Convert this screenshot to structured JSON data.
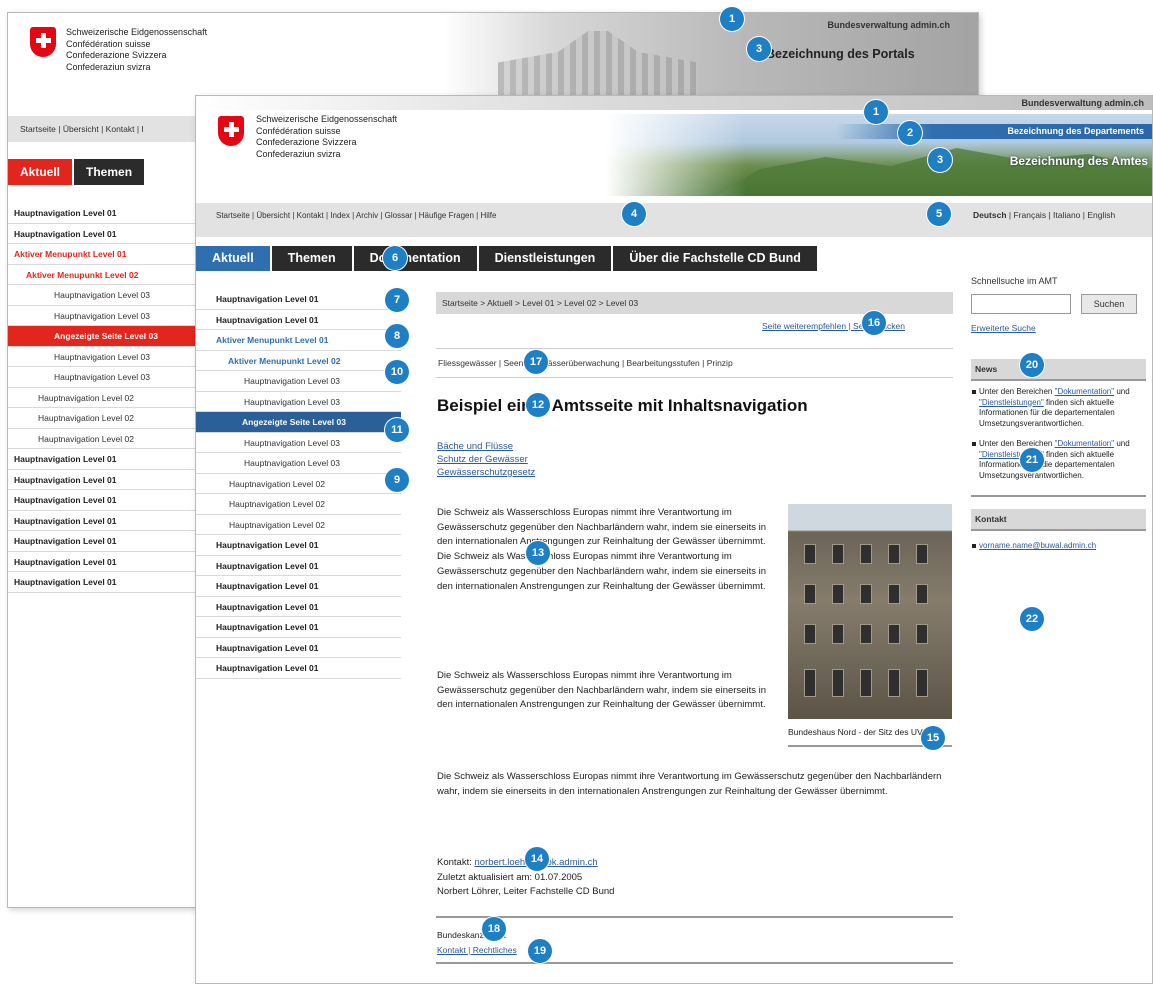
{
  "confederation": [
    "Schweizerische Eidgenossenschaft",
    "Confédération suisse",
    "Confederazione Svizzera",
    "Confederaziun svizra"
  ],
  "back": {
    "bundesverwaltung": "Bundesverwaltung admin.ch",
    "portal": "Bezeichnung des Portals",
    "service_links": "Startseite | Übersicht | Kontakt | I",
    "tabs": [
      "Aktuell",
      "Themen"
    ],
    "nav": [
      {
        "label": "Hauptnavigation Level 01",
        "type": "l1"
      },
      {
        "label": "Hauptnavigation Level 01",
        "type": "l1"
      },
      {
        "label": "Aktiver Menupunkt Level 01",
        "type": "act1"
      },
      {
        "label": "Aktiver Menupunkt Level 02",
        "type": "act2"
      },
      {
        "label": "Hauptnavigation Level 03",
        "type": "l3"
      },
      {
        "label": "Hauptnavigation Level 03",
        "type": "l3"
      },
      {
        "label": "Angezeigte Seite Level 03",
        "type": "cur3"
      },
      {
        "label": "Hauptnavigation Level 03",
        "type": "l3"
      },
      {
        "label": "Hauptnavigation Level 03",
        "type": "l3"
      },
      {
        "label": "Hauptnavigation Level 02",
        "type": "l2"
      },
      {
        "label": "Hauptnavigation Level 02",
        "type": "l2"
      },
      {
        "label": "Hauptnavigation Level 02",
        "type": "l2"
      },
      {
        "label": "Hauptnavigation Level 01",
        "type": "l1"
      },
      {
        "label": "Hauptnavigation Level 01",
        "type": "l1"
      },
      {
        "label": "Hauptnavigation Level 01",
        "type": "l1"
      },
      {
        "label": "Hauptnavigation Level 01",
        "type": "l1"
      },
      {
        "label": "Hauptnavigation Level 01",
        "type": "l1"
      },
      {
        "label": "Hauptnavigation Level 01",
        "type": "l1"
      },
      {
        "label": "Hauptnavigation Level 01",
        "type": "l1"
      }
    ]
  },
  "front": {
    "bundesverwaltung": "Bundesverwaltung admin.ch",
    "departement": "Bezeichnung des Departements",
    "amt": "Bezeichnung des Amtes",
    "service_links": "Startseite | Übersicht | Kontakt | Index | Archiv | Glossar | Häufige Fragen | Hilfe",
    "language": {
      "active": "Deutsch",
      "others": " | Français | Italiano | English"
    },
    "tabs": [
      "Aktuell",
      "Themen",
      "Dokumentation",
      "Dienstleistungen",
      "Über die Fachstelle CD Bund"
    ],
    "nav": [
      {
        "label": "Hauptnavigation Level 01",
        "type": "l1"
      },
      {
        "label": "Hauptnavigation Level 01",
        "type": "l1"
      },
      {
        "label": "Aktiver Menupunkt Level 01",
        "type": "act1"
      },
      {
        "label": "Aktiver Menupunkt Level 02",
        "type": "act2"
      },
      {
        "label": "Hauptnavigation Level 03",
        "type": "l3"
      },
      {
        "label": "Hauptnavigation Level 03",
        "type": "l3"
      },
      {
        "label": "Angezeigte Seite Level 03",
        "type": "cur3"
      },
      {
        "label": "Hauptnavigation Level 03",
        "type": "l3"
      },
      {
        "label": "Hauptnavigation Level 03",
        "type": "l3"
      },
      {
        "label": "Hauptnavigation Level 02",
        "type": "l2"
      },
      {
        "label": "Hauptnavigation Level 02",
        "type": "l2"
      },
      {
        "label": "Hauptnavigation Level 02",
        "type": "l2"
      },
      {
        "label": "Hauptnavigation Level 01",
        "type": "l1"
      },
      {
        "label": "Hauptnavigation Level 01",
        "type": "l1"
      },
      {
        "label": "Hauptnavigation Level 01",
        "type": "l1"
      },
      {
        "label": "Hauptnavigation Level 01",
        "type": "l1"
      },
      {
        "label": "Hauptnavigation Level 01",
        "type": "l1"
      },
      {
        "label": "Hauptnavigation Level 01",
        "type": "l1"
      },
      {
        "label": "Hauptnavigation Level 01",
        "type": "l1"
      }
    ],
    "breadcrumb": "Startseite > Aktuell > Level 01 > Level 02 > Level 03",
    "page_tools": "Seite weiterempfehlen | Seite drucken",
    "content_nav": "Fliessgewässer | Seen | Gewässerüberwachung | Bearbeitungsstufen | Prinzip",
    "title": "Beispiel einer Amtsseite mit Inhaltsnavigation",
    "anchors": [
      "Bäche und Flüsse",
      "Schutz der Gewässer",
      "Gewässerschutzgesetz"
    ],
    "para1": "Die Schweiz als Wasserschloss Europas nimmt ihre Verantwortung im Gewässerschutz gegenüber den Nachbarländern wahr, indem sie einerseits in den internationalen Anstrengungen zur Reinhaltung der Gewässer übernimmt. Die Schweiz als Wasserschloss Europas nimmt ihre Verantwortung im Gewässerschutz gegenüber den Nachbarländern wahr, indem sie einerseits in den internationalen Anstrengungen zur Reinhaltung der Gewässer übernimmt.",
    "para2": "Die Schweiz als Wasserschloss Europas nimmt ihre Verantwortung im Gewässerschutz gegenüber den Nachbarländern wahr, indem sie einerseits in den internationalen Anstrengungen zur Reinhaltung der Gewässer übernimmt.",
    "para3": "Die Schweiz als Wasserschloss Europas nimmt ihre Verantwortung im Gewässerschutz gegenüber den Nachbarländern wahr, indem sie einerseits in den internationalen Anstrengungen zur Reinhaltung der Gewässer übernimmt.",
    "caption": "Bundeshaus Nord - der Sitz des UVEK",
    "contact": {
      "label": "Kontakt: ",
      "email": "norbert.loehrer@bk.admin.ch",
      "updated": "Zuletzt aktualisiert am: 01.07.2005",
      "author": "Norbert Löhrer, Leiter Fachstelle CD Bund"
    },
    "footer": {
      "org": "Bundeskanzlei BK",
      "links": "Kontakt | Rechtliches"
    },
    "quicksearch": {
      "label": "Schnellsuche im AMT",
      "button": "Suchen",
      "advanced": "Erweiterte Suche"
    },
    "news": {
      "title": "News",
      "items": [
        {
          "pre": "Unter den Bereichen ",
          "link1": "\"Dokumentation\"",
          "mid": " und ",
          "link2": "\"Dienstleistungen\"",
          "post": " finden sich aktuelle Informationen für die departementalen Umsetzungsverantwortlichen."
        },
        {
          "pre": "Unter den Bereichen ",
          "link1": "\"Dokumentation\"",
          "mid": " und ",
          "link2": "\"Dienstleistungen\"",
          "post": " finden sich aktuelle Informationen für die departementalen Umsetzungsverantwortlichen."
        }
      ]
    },
    "kontakt_box": {
      "title": "Kontakt",
      "email": "vorname.name@buwal.admin.ch"
    }
  },
  "badges": [
    "1",
    "3",
    "1",
    "2",
    "3",
    "4",
    "5",
    "6",
    "7",
    "8",
    "10",
    "11",
    "9",
    "16",
    "17",
    "12",
    "13",
    "15",
    "14",
    "18",
    "19",
    "20",
    "21",
    "22"
  ]
}
